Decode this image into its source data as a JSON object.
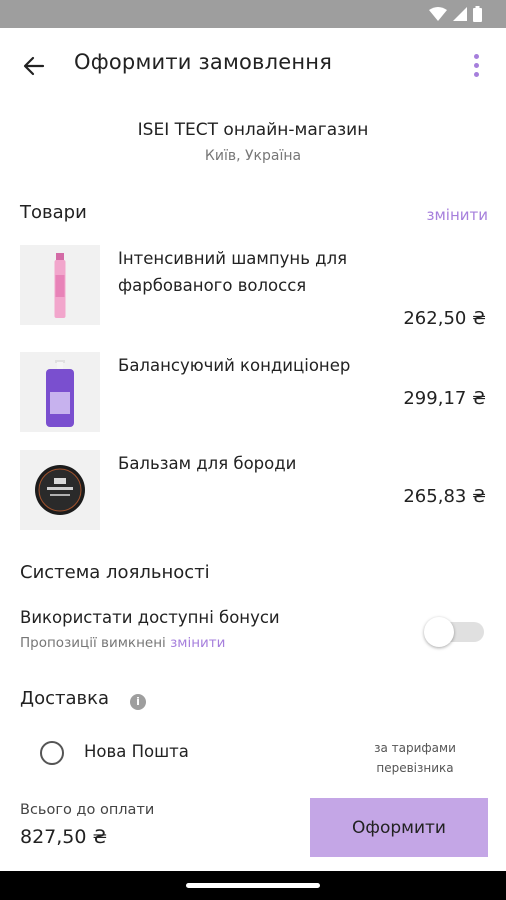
{
  "header": {
    "title": "Оформити замовлення"
  },
  "store": {
    "name": "ISEI TECT онлайн-магазин",
    "city": "Київ, Україна"
  },
  "products": {
    "section_title": "Товари",
    "change_label": "змінити",
    "items": [
      {
        "name": "Інтенсивний шампунь для фарбованого волосся",
        "price": "262,50 ₴"
      },
      {
        "name": "Балансуючий кондиціонер",
        "price": "299,17 ₴"
      },
      {
        "name": "Бальзам для бороди",
        "price": "265,83 ₴"
      }
    ]
  },
  "loyalty": {
    "section_title": "Система лояльності",
    "use_bonuses_label": "Використати доступні бонуси",
    "offers_disabled_text": "Пропозиції вимкнені",
    "change_label": "змінити",
    "toggle_on": false
  },
  "delivery": {
    "section_title": "Доставка",
    "option_name": "Нова Пошта",
    "option_note": "за тарифами перевізника",
    "selected": false
  },
  "footer": {
    "total_label": "Всього до оплати",
    "total_value": "827,50 ₴",
    "checkout_label": "Оформити"
  },
  "colors": {
    "accent": "#a67fdc",
    "button_bg": "#c4a6e6",
    "status_bar": "#9e9e9e"
  },
  "icons": [
    "wifi-icon",
    "signal-icon",
    "battery-icon",
    "back-arrow-icon",
    "more-vert-icon",
    "info-icon",
    "radio-icon"
  ]
}
